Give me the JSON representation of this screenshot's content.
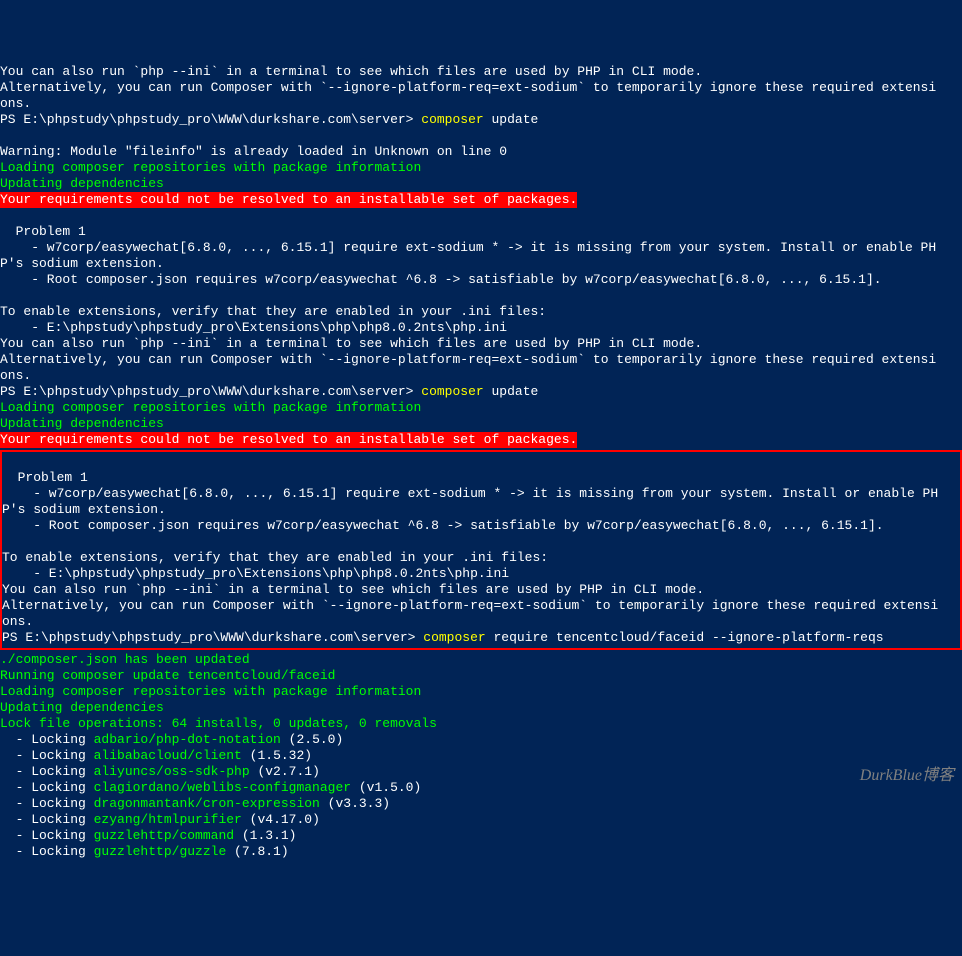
{
  "pre_lines": [
    "You can also run `php --ini` in a terminal to see which files are used by PHP in CLI mode.",
    "Alternatively, you can run Composer with `--ignore-platform-req=ext-sodium` to temporarily ignore these required extensi",
    "ons."
  ],
  "prompt1": {
    "path": "PS E:\\phpstudy\\phpstudy_pro\\WWW\\durkshare.com\\server> ",
    "cmd": "composer",
    "args": " update"
  },
  "warning_line": "Warning: Module \"fileinfo\" is already loaded in Unknown on line 0",
  "loading1": "Loading composer repositories with package information",
  "updating1": "Updating dependencies",
  "error1": "Your requirements could not be resolved to an installable set of packages.",
  "problem1": [
    "  Problem 1",
    "    - w7corp/easywechat[6.8.0, ..., 6.15.1] require ext-sodium * -> it is missing from your system. Install or enable PH",
    "P's sodium extension.",
    "    - Root composer.json requires w7corp/easywechat ^6.8 -> satisfiable by w7corp/easywechat[6.8.0, ..., 6.15.1].",
    "",
    "To enable extensions, verify that they are enabled in your .ini files:",
    "    - E:\\phpstudy\\phpstudy_pro\\Extensions\\php\\php8.0.2nts\\php.ini",
    "You can also run `php --ini` in a terminal to see which files are used by PHP in CLI mode.",
    "Alternatively, you can run Composer with `--ignore-platform-req=ext-sodium` to temporarily ignore these required extensi",
    "ons."
  ],
  "prompt2": {
    "path": "PS E:\\phpstudy\\phpstudy_pro\\WWW\\durkshare.com\\server> ",
    "cmd": "composer",
    "args": " update"
  },
  "loading2": "Loading composer repositories with package information",
  "updating2": "Updating dependencies",
  "error2": "Your requirements could not be resolved to an installable set of packages.",
  "problem2": [
    "",
    "  Problem 1",
    "    - w7corp/easywechat[6.8.0, ..., 6.15.1] require ext-sodium * -> it is missing from your system. Install or enable PH",
    "P's sodium extension.",
    "    - Root composer.json requires w7corp/easywechat ^6.8 -> satisfiable by w7corp/easywechat[6.8.0, ..., 6.15.1].",
    "",
    "To enable extensions, verify that they are enabled in your .ini files:",
    "    - E:\\phpstudy\\phpstudy_pro\\Extensions\\php\\php8.0.2nts\\php.ini",
    "You can also run `php --ini` in a terminal to see which files are used by PHP in CLI mode.",
    "Alternatively, you can run Composer with `--ignore-platform-req=ext-sodium` to temporarily ignore these required extensi",
    "ons."
  ],
  "prompt3": {
    "path": "PS E:\\phpstudy\\phpstudy_pro\\WWW\\durkshare.com\\server> ",
    "cmd": "composer",
    "args": " require tencentcloud/faceid --ignore-platform-reqs"
  },
  "after_require": [
    "./composer.json has been updated",
    "Running composer update tencentcloud/faceid",
    "Loading composer repositories with package information",
    "Updating dependencies",
    "Lock file operations: 64 installs, 0 updates, 0 removals"
  ],
  "locks": [
    {
      "prefix": "  - Locking ",
      "pkg": "adbario/php-dot-notation",
      "ver": " (2.5.0)"
    },
    {
      "prefix": "  - Locking ",
      "pkg": "alibabacloud/client",
      "ver": " (1.5.32)"
    },
    {
      "prefix": "  - Locking ",
      "pkg": "aliyuncs/oss-sdk-php",
      "ver": " (v2.7.1)"
    },
    {
      "prefix": "  - Locking ",
      "pkg": "clagiordano/weblibs-configmanager",
      "ver": " (v1.5.0)"
    },
    {
      "prefix": "  - Locking ",
      "pkg": "dragonmantank/cron-expression",
      "ver": " (v3.3.3)"
    },
    {
      "prefix": "  - Locking ",
      "pkg": "ezyang/htmlpurifier",
      "ver": " (v4.17.0)"
    },
    {
      "prefix": "  - Locking ",
      "pkg": "guzzlehttp/command",
      "ver": " (1.3.1)"
    },
    {
      "prefix": "  - Locking ",
      "pkg": "guzzlehttp/guzzle",
      "ver": " (7.8.1)"
    }
  ],
  "watermark": "DurkBlue博客"
}
